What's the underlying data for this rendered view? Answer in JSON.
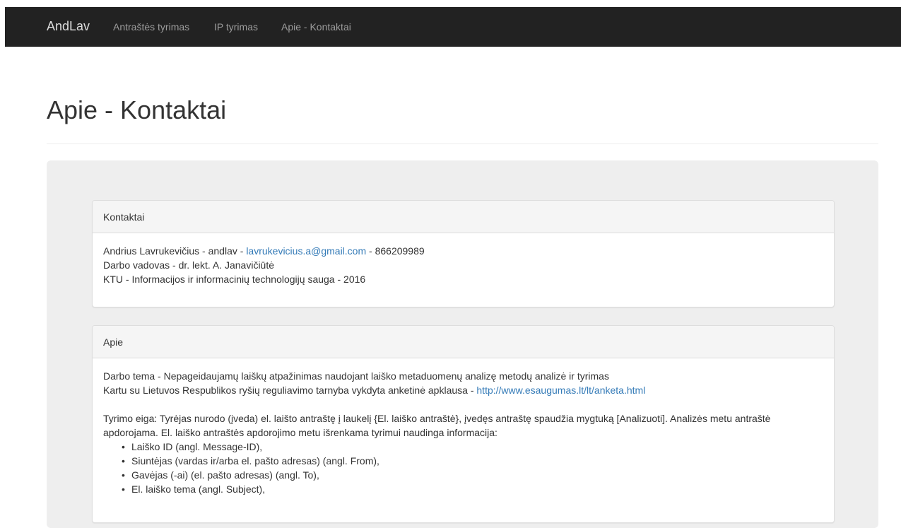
{
  "nav": {
    "brand": "AndLav",
    "links": [
      "Antraštės tyrimas",
      "IP tyrimas",
      "Apie - Kontaktai"
    ]
  },
  "page": {
    "title": "Apie - Kontaktai"
  },
  "contacts_panel": {
    "heading": "Kontaktai",
    "author_prefix": "Andrius Lavrukevičius - andlav - ",
    "email": "lavrukevicius.a@gmail.com",
    "phone_suffix": " - 866209989",
    "supervisor": "Darbo vadovas - dr. lekt. A. Janavičiūtė",
    "university": "KTU - Informacijos ir informacinių technologijų sauga - 2016"
  },
  "about_panel": {
    "heading": "Apie",
    "topic": "Darbo tema - Nepageidaujamų laiškų atpažinimas naudojant laiško metaduomenų analizę metodų analizė ir tyrimas",
    "survey_prefix": "Kartu su Lietuvos Respublikos ryšių reguliavimo tarnyba vykdyta anketinė apklausa - ",
    "survey_link": "http://www.esaugumas.lt/lt/anketa.html",
    "procedure": "Tyrimo eiga: Tyrėjas nurodo (įveda) el. laišto antraštę į laukelį {El. laiško antraštė}, įvedęs antraštę spaudžia mygtuką [Analizuoti]. Analizės metu antraštė apdorojama. El. laiško antraštės apdorojimo metu išrenkama tyrimui naudinga informacija:",
    "items": [
      "Laiško ID (angl. Message-ID),",
      "Siuntėjas (vardas ir/arba el. pašto adresas) (angl. From),",
      "Gavėjas (-ai) (el. pašto adresas) (angl. To),",
      "El. laiško tema (angl. Subject),"
    ],
    "bullet": "•"
  },
  "colors": {
    "navbar_bg": "#222222",
    "link": "#337ab7",
    "jumbotron_bg": "#eeeeee"
  }
}
